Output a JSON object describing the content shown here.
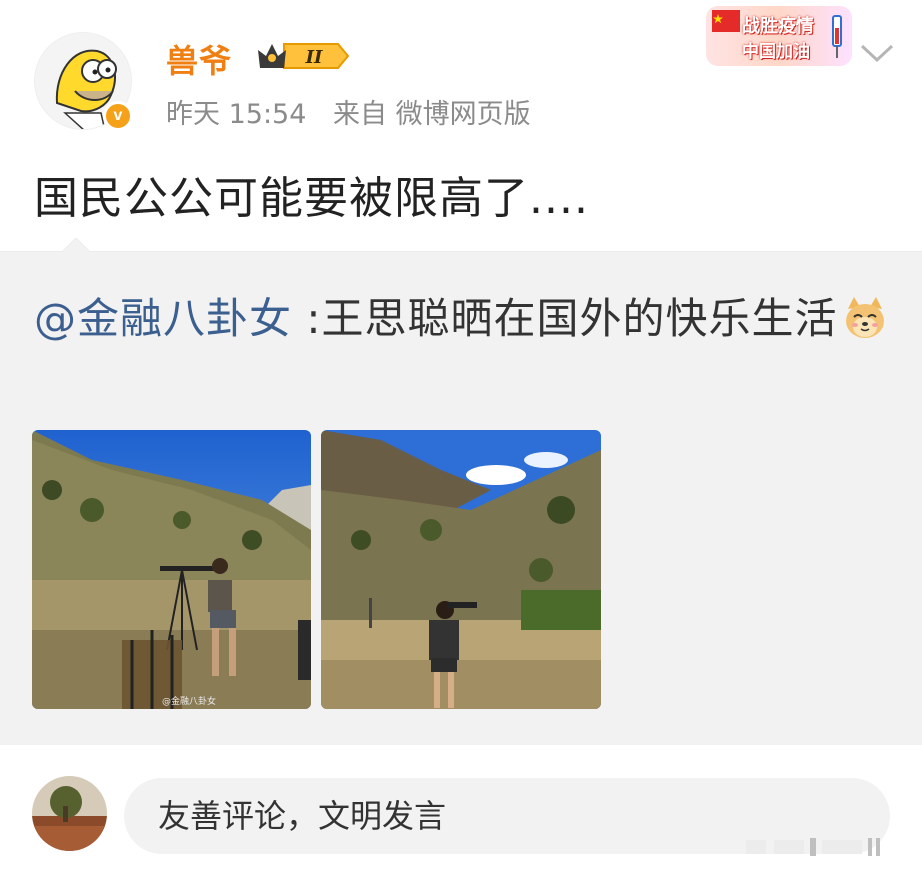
{
  "post": {
    "username": "兽爷",
    "level": "II",
    "time": "昨天 15:54",
    "source": "来自 微博网页版",
    "text": "国民公公可能要被限高了....",
    "verified_mark": "v"
  },
  "promo": {
    "line1": "战胜疫情",
    "line2": "中国加油"
  },
  "repost": {
    "mention": "@金融八卦女",
    "text": " :王思聪晒在国外的快乐生活",
    "emoji": "dog-face-emoji",
    "images": [
      {
        "name": "shooting-range-photo-1",
        "watermark": "@金融八卦女"
      },
      {
        "name": "shooting-range-photo-2"
      }
    ]
  },
  "comment": {
    "placeholder": "友善评论，文明发言"
  },
  "icons": {
    "expand": "chevron-down-icon",
    "level": "crown-level-badge"
  },
  "colors": {
    "username": "#f07f13",
    "mention": "#3b5f8f",
    "meta": "#8b8b8b",
    "repost_bg": "#f2f2f2"
  }
}
